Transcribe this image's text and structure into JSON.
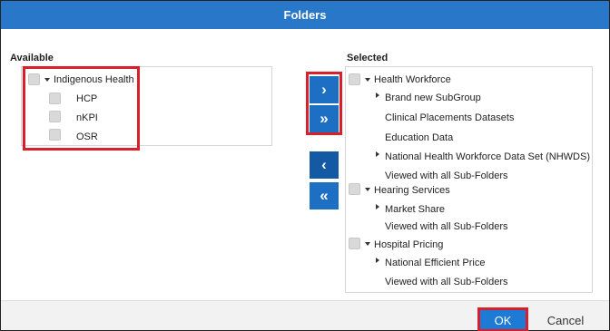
{
  "dialog": {
    "title": "Folders"
  },
  "available": {
    "label": "Available",
    "group": {
      "label": "Indigenous Health",
      "children": [
        "HCP",
        "nKPI",
        "OSR"
      ]
    }
  },
  "selected": {
    "label": "Selected",
    "groups": [
      {
        "label": "Health Workforce",
        "children": [
          {
            "label": "Brand new SubGroup",
            "expandable": true
          },
          {
            "label": "Clinical Placements Datasets",
            "expandable": false
          },
          {
            "label": "Education Data",
            "expandable": false
          },
          {
            "label": "National Health Workforce Data Set (NHWDS)",
            "expandable": true
          },
          {
            "label": "Viewed with all Sub-Folders",
            "expandable": false
          }
        ]
      },
      {
        "label": "Hearing Services",
        "children": [
          {
            "label": "Market Share",
            "expandable": true
          },
          {
            "label": "Viewed with all Sub-Folders",
            "expandable": false
          }
        ]
      },
      {
        "label": "Hospital Pricing",
        "children": [
          {
            "label": "National Efficient Price",
            "expandable": true
          },
          {
            "label": "Viewed with all Sub-Folders",
            "expandable": false
          }
        ]
      }
    ]
  },
  "move_buttons": {
    "add": "›",
    "add_all": "»",
    "remove": "‹",
    "remove_all": "«"
  },
  "footer": {
    "ok_label": "OK",
    "cancel_label": "Cancel"
  },
  "colors": {
    "title_bar": "#2877c9",
    "button": "#1d6fc4",
    "highlight": "#d8202c"
  },
  "icons": {
    "expand": "caret-down-icon",
    "collapse": "caret-right-icon",
    "checkbox": "checkbox-icon"
  }
}
